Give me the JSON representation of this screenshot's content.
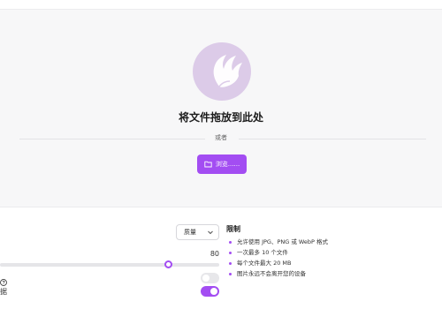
{
  "upload": {
    "title": "将文件拖放到此处",
    "or_text": "或者",
    "browse_label": "浏览......"
  },
  "settings": {
    "format_select": "质量",
    "quality_value": "80",
    "quality": 80,
    "toggle_1_on": false,
    "toggle_2_on": true,
    "cut_label": "据"
  },
  "limits": {
    "title": "限制",
    "items": [
      "允许使用 JPG、PNG 或 WebP 格式",
      "一次最多 10 个文件",
      "每个文件最大 20 MB",
      "图片永远不会离开您的设备"
    ]
  },
  "colors": {
    "accent": "#a34df2",
    "logo_bg": "#dccbe8",
    "dropzone_bg": "#f7f7f8"
  },
  "icons": [
    "logo-icon",
    "folder-icon",
    "chevron-down-icon",
    "help-icon"
  ]
}
